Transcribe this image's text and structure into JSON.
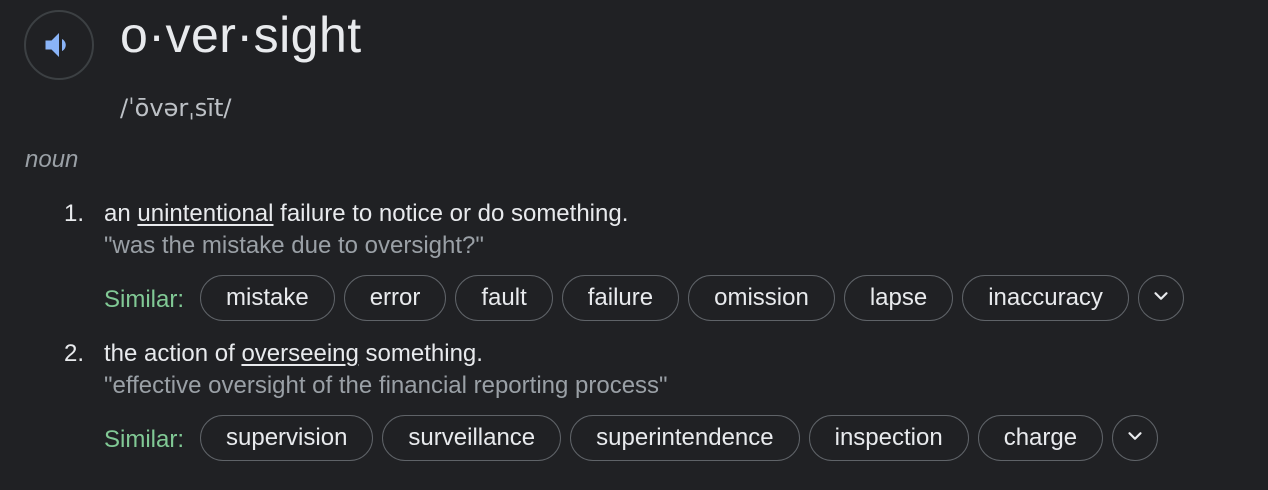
{
  "entry": {
    "headword": "o·ver·sight",
    "phonetic": "/ˈōvərˌsīt/",
    "part_of_speech": "noun",
    "speaker_icon": "volume-up-icon"
  },
  "senses": [
    {
      "number": "1.",
      "gloss_before": "an ",
      "gloss_link": "unintentional",
      "gloss_after": " failure to notice or do something.",
      "example": "\"was the mistake due to oversight?\"",
      "similar_label": "Similar:",
      "similar": [
        "mistake",
        "error",
        "fault",
        "failure",
        "omission",
        "lapse",
        "inaccuracy"
      ]
    },
    {
      "number": "2.",
      "gloss_before": "the action of ",
      "gloss_link": "overseeing",
      "gloss_after": " something.",
      "example": "\"effective oversight of the financial reporting process\"",
      "similar_label": "Similar:",
      "similar": [
        "supervision",
        "surveillance",
        "superintendence",
        "inspection",
        "charge"
      ]
    }
  ],
  "colors": {
    "background": "#202124",
    "text": "#e8eaed",
    "muted": "#9aa0a6",
    "similar_label": "#81c995",
    "speaker_icon": "#8ab4f8",
    "chip_border": "#5f6368"
  }
}
